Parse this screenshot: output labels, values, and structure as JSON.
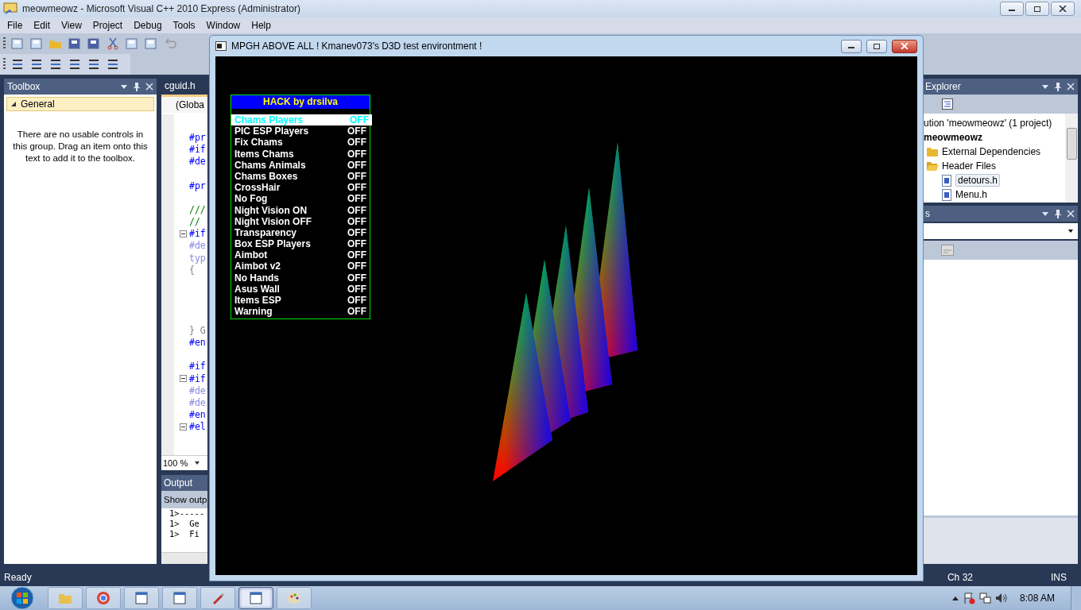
{
  "ide": {
    "title": "meowmeowz - Microsoft Visual C++ 2010 Express (Administrator)",
    "menu": [
      "File",
      "Edit",
      "View",
      "Project",
      "Debug",
      "Tools",
      "Window",
      "Help"
    ]
  },
  "toolbox": {
    "title": "Toolbox",
    "group": {
      "label": "General",
      "expanded": true
    },
    "message": "There are no usable controls in this group. Drag an item onto this text to add it to the toolbox."
  },
  "editor": {
    "tab": "cguid.h",
    "scope": "(Globa",
    "zoom": "100 %",
    "lines": [
      {
        "kind": "blank",
        "fold": false
      },
      {
        "kind": "directive",
        "text": "#pr",
        "fold": false
      },
      {
        "kind": "directive",
        "text": "#if",
        "fold": false
      },
      {
        "kind": "directive",
        "text": "#de",
        "fold": false
      },
      {
        "kind": "blank",
        "fold": false
      },
      {
        "kind": "directive",
        "text": "#pr",
        "fold": false
      },
      {
        "kind": "blank",
        "fold": false
      },
      {
        "kind": "comment",
        "text": "///",
        "fold": false
      },
      {
        "kind": "comment",
        "text": "//",
        "fold": false
      },
      {
        "kind": "directive",
        "text": "#if",
        "fold": true
      },
      {
        "kind": "inactive",
        "text": "#de",
        "fold": false
      },
      {
        "kind": "inactive",
        "text": "typ",
        "fold": false
      },
      {
        "kind": "plain",
        "text": "{",
        "fold": false
      },
      {
        "kind": "blank",
        "fold": false
      },
      {
        "kind": "blank",
        "fold": false
      },
      {
        "kind": "blank",
        "fold": false
      },
      {
        "kind": "blank",
        "fold": false
      },
      {
        "kind": "plain",
        "text": "} G",
        "fold": false
      },
      {
        "kind": "directive",
        "text": "#en",
        "fold": false
      },
      {
        "kind": "blank",
        "fold": false
      },
      {
        "kind": "directive",
        "text": "#if",
        "fold": false
      },
      {
        "kind": "directive",
        "text": "#if",
        "fold": true
      },
      {
        "kind": "inactive",
        "text": "#de",
        "fold": false
      },
      {
        "kind": "inactive",
        "text": "#de",
        "fold": false
      },
      {
        "kind": "directive",
        "text": "#en",
        "fold": false
      },
      {
        "kind": "directive",
        "text": "#el",
        "fold": true
      }
    ]
  },
  "output": {
    "title": "Output",
    "toolbar_label": "Show outp",
    "lines": [
      "1>-----",
      "1>  Ge",
      "1>  Fi"
    ]
  },
  "solution_explorer": {
    "title": "Explorer",
    "tree": [
      {
        "label": "ution 'meowmeowz' (1 project)",
        "kind": "solution",
        "children": [
          {
            "label": "meowmeowz",
            "kind": "project",
            "children": [
              {
                "label": "External Dependencies",
                "kind": "folder",
                "expanded": false
              },
              {
                "label": "Header Files",
                "kind": "folder",
                "expanded": true,
                "children": [
                  {
                    "label": "detours.h",
                    "kind": "file",
                    "selected": true
                  },
                  {
                    "label": "Menu.h",
                    "kind": "file",
                    "selected": false
                  }
                ]
              }
            ]
          }
        ]
      }
    ]
  },
  "properties": {
    "title": "s"
  },
  "status_bar": {
    "message": "Ready",
    "position": "Ch 32",
    "mode": "INS"
  },
  "d3d_window": {
    "title": "MPGH ABOVE ALL ! Kmanev073's D3D test environtment !",
    "menu": {
      "title": "HACK by drsilva",
      "items": [
        {
          "label": "Chams Players",
          "value": "OFF",
          "selected": true
        },
        {
          "label": "PIC ESP Players",
          "value": "OFF",
          "selected": false
        },
        {
          "label": "Fix Chams",
          "value": "OFF",
          "selected": false
        },
        {
          "label": "Items Chams",
          "value": "OFF",
          "selected": false
        },
        {
          "label": "Chams Animals",
          "value": "OFF",
          "selected": false
        },
        {
          "label": "Chams Boxes",
          "value": "OFF",
          "selected": false
        },
        {
          "label": "CrossHair",
          "value": "OFF",
          "selected": false
        },
        {
          "label": "No Fog",
          "value": "OFF",
          "selected": false
        },
        {
          "label": "Night Vision ON",
          "value": "OFF",
          "selected": false
        },
        {
          "label": "Night Vision OFF",
          "value": "OFF",
          "selected": false
        },
        {
          "label": "Transparency",
          "value": "OFF",
          "selected": false
        },
        {
          "label": "Box ESP Players",
          "value": "OFF",
          "selected": false
        },
        {
          "label": "Aimbot",
          "value": "OFF",
          "selected": false
        },
        {
          "label": "Aimbot v2",
          "value": "OFF",
          "selected": false
        },
        {
          "label": "No Hands",
          "value": "OFF",
          "selected": false
        },
        {
          "label": "Asus Wall",
          "value": "OFF",
          "selected": false
        },
        {
          "label": "Items ESP",
          "value": "OFF",
          "selected": false
        },
        {
          "label": "Warning",
          "value": "OFF",
          "selected": false
        }
      ]
    }
  },
  "taskbar": {
    "buttons": [
      {
        "kind": "folder",
        "selected": false
      },
      {
        "kind": "browser",
        "selected": false
      },
      {
        "kind": "ide",
        "selected": false
      },
      {
        "kind": "media",
        "selected": false
      },
      {
        "kind": "tool",
        "selected": false
      },
      {
        "kind": "window",
        "selected": true
      },
      {
        "kind": "paint",
        "selected": false
      }
    ],
    "clock": "8:08 AM"
  }
}
